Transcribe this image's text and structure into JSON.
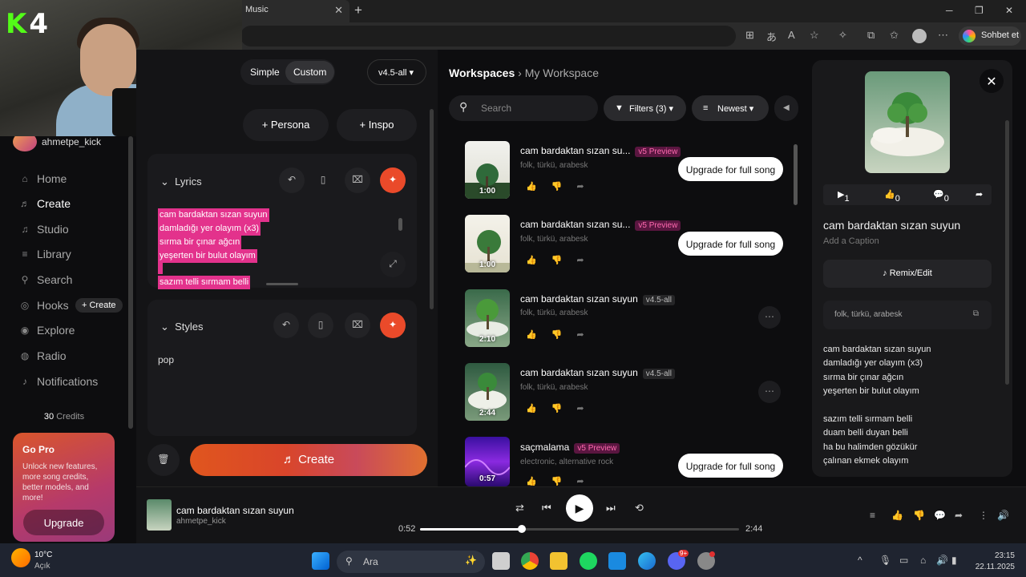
{
  "browser": {
    "tab_title": "Music",
    "copilot_label": "Sohbet et"
  },
  "stream": {
    "logo": "K",
    "logo_num": "4"
  },
  "sidebar": {
    "username": "ahmetpe_kick",
    "nav": [
      {
        "label": "Home",
        "icon": "home-icon"
      },
      {
        "label": "Create",
        "icon": "music-note-icon"
      },
      {
        "label": "Studio",
        "icon": "studio-icon"
      },
      {
        "label": "Library",
        "icon": "library-icon"
      },
      {
        "label": "Search",
        "icon": "search-icon"
      },
      {
        "label": "Hooks",
        "icon": "hooks-icon"
      },
      {
        "label": "Explore",
        "icon": "explore-icon"
      },
      {
        "label": "Radio",
        "icon": "radio-icon"
      },
      {
        "label": "Notifications",
        "icon": "bell-icon"
      }
    ],
    "hooks_create": "+ Create",
    "credits_num": "30",
    "credits_label": "Credits",
    "gopro": {
      "title": "Go Pro",
      "desc": "Unlock new features, more song credits, better models, and more!",
      "button": "Upgrade"
    }
  },
  "create": {
    "mode_simple": "Simple",
    "mode_custom": "Custom",
    "version": "v4.5-all",
    "persona": "+ Persona",
    "inspo": "+ Inspo",
    "lyrics_title": "Lyrics",
    "lyrics_lines": [
      "cam bardaktan sızan suyun",
      "damladığı yer olayım (x3)",
      "sırma bir çınar ağcın",
      "yeşerten bir bulut olayım",
      "",
      "sazım telli sırmam belli"
    ],
    "styles_title": "Styles",
    "styles_value": "pop",
    "create_button": "Create"
  },
  "workspace": {
    "crumb_root": "Workspaces",
    "crumb_current": "My Workspace",
    "search_placeholder": "Search",
    "filters": "Filters (3)",
    "sort": "Newest",
    "songs": [
      {
        "title": "cam bardaktan sızan su...",
        "tag": "v5 Preview",
        "genre": "folk, türkü, arabesk",
        "duration": "1:00",
        "upgrade": "Upgrade for full song"
      },
      {
        "title": "cam bardaktan sızan su...",
        "tag": "v5 Preview",
        "genre": "folk, türkü, arabesk",
        "duration": "1:00",
        "upgrade": "Upgrade for full song"
      },
      {
        "title": "cam bardaktan sızan suyun",
        "tag": "v4.5-all",
        "genre": "folk, türkü, arabesk",
        "duration": "2:10"
      },
      {
        "title": "cam bardaktan sızan suyun",
        "tag": "v4.5-all",
        "genre": "folk, türkü, arabesk",
        "duration": "2:44"
      },
      {
        "title": "saçmalama",
        "tag": "v5 Preview",
        "genre": "electronic, alternative rock",
        "duration": "0:57",
        "upgrade": "Upgrade for full song"
      }
    ]
  },
  "detail": {
    "plays": "1",
    "likes": "0",
    "comments": "0",
    "title": "cam bardaktan sızan suyun",
    "caption": "Add a Caption",
    "remix": "Remix/Edit",
    "styles": "folk, türkü, arabesk",
    "lyrics": [
      "cam bardaktan sızan suyun",
      "damladığı yer olayım (x3)",
      "sırma bir çınar ağcın",
      "yeşerten bir bulut olayım",
      "",
      "sazım telli sırmam belli",
      "duam belli duyan belli",
      "ha bu halimden gözükür",
      "çalınan ekmek olayım"
    ]
  },
  "player": {
    "title": "cam bardaktan sızan suyun",
    "artist": "ahmetpe_kick",
    "current": "0:52",
    "total": "2:44",
    "progress": 0.32
  },
  "taskbar": {
    "temp": "10°C",
    "weather": "Açık",
    "search": "Ara",
    "time": "23:15",
    "date": "22.11.2025",
    "discord_badge": "9+"
  }
}
